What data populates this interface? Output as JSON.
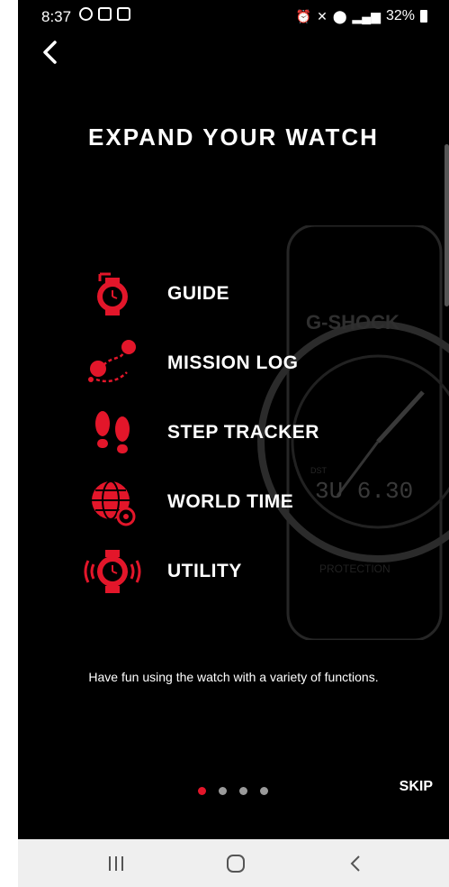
{
  "status_bar": {
    "time": "8:37",
    "battery": "32%"
  },
  "title": "EXPAND YOUR WATCH",
  "features": [
    {
      "label": "GUIDE",
      "icon": "guide-watch-icon"
    },
    {
      "label": "MISSION LOG",
      "icon": "mission-log-route-icon"
    },
    {
      "label": "STEP TRACKER",
      "icon": "footprints-icon"
    },
    {
      "label": "WORLD TIME",
      "icon": "globe-clock-icon"
    },
    {
      "label": "UTILITY",
      "icon": "watch-signal-icon"
    }
  ],
  "watch_bg": {
    "brand": "G-SHOCK",
    "digits": "3U 6.30",
    "small_label": "DST",
    "band_text": "PROTECTION"
  },
  "description": "Have fun using the watch with a variety of functions.",
  "pager": {
    "total": 4,
    "current": 1
  },
  "skip_label": "SKIP",
  "colors": {
    "accent": "#e3162a",
    "background": "#000000"
  }
}
